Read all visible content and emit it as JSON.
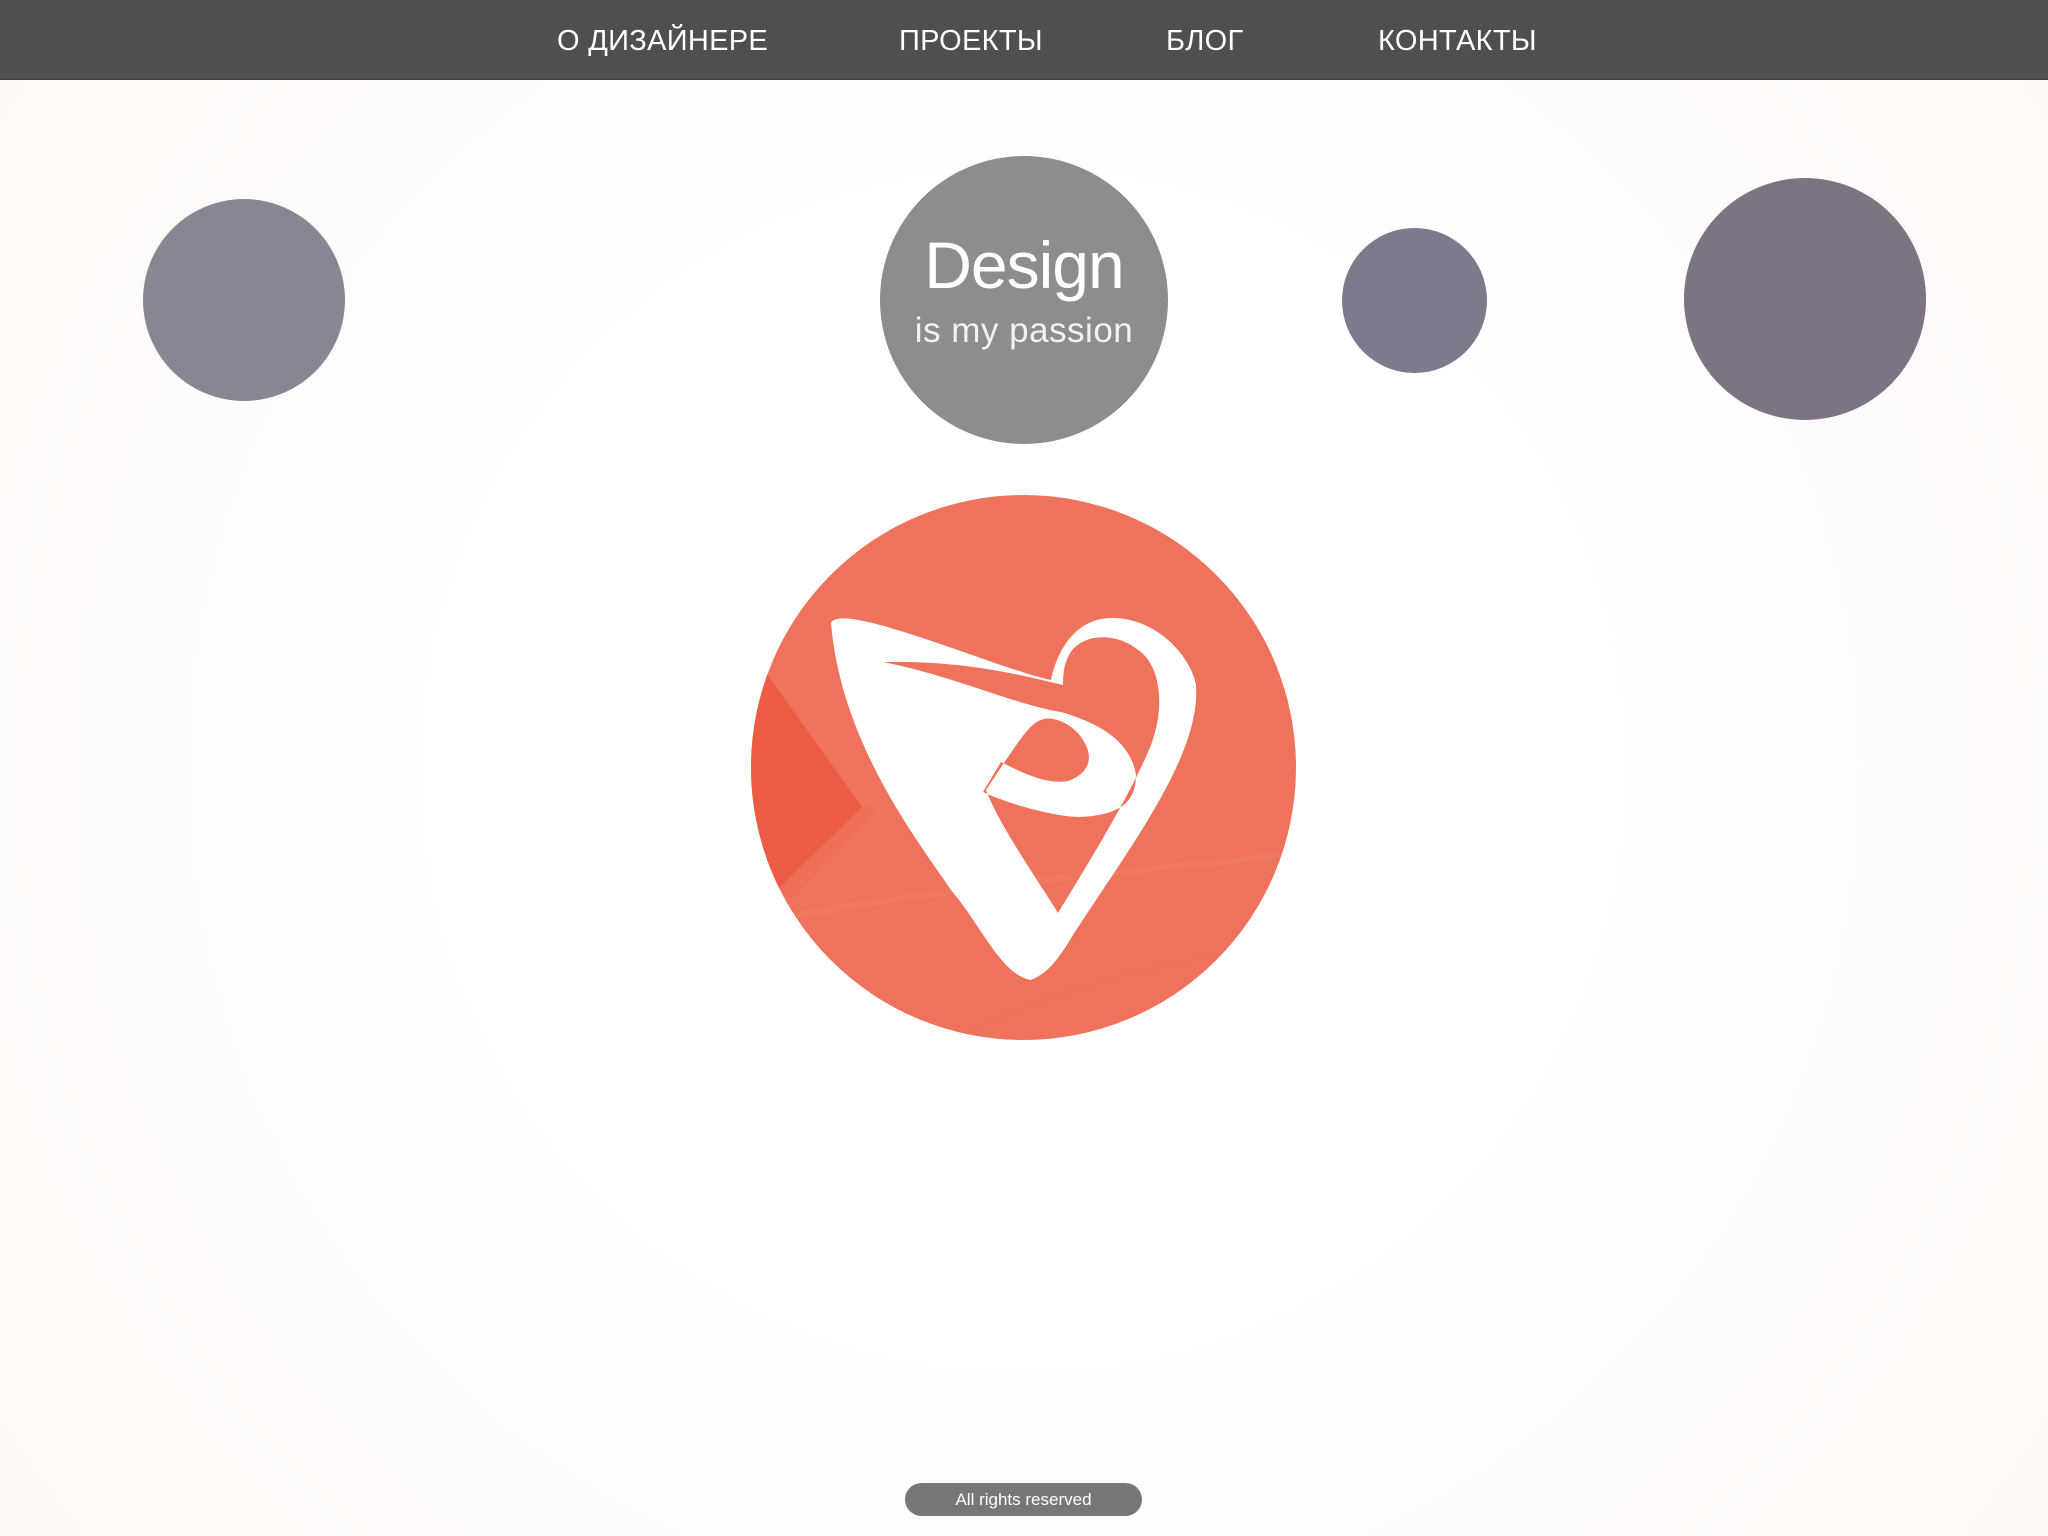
{
  "nav": {
    "items": [
      {
        "label": "О ДИЗАЙНЕРЕ"
      },
      {
        "label": "ПРОЕКТЫ"
      },
      {
        "label": "БЛОГ"
      },
      {
        "label": "КОНТАКТЫ"
      }
    ]
  },
  "hero": {
    "title": "Design",
    "subtitle": "is my passion"
  },
  "logo": {
    "icon": "heart-arrow-logo-icon",
    "color": "#ef735c"
  },
  "footer": {
    "text": "All rights reserved"
  }
}
